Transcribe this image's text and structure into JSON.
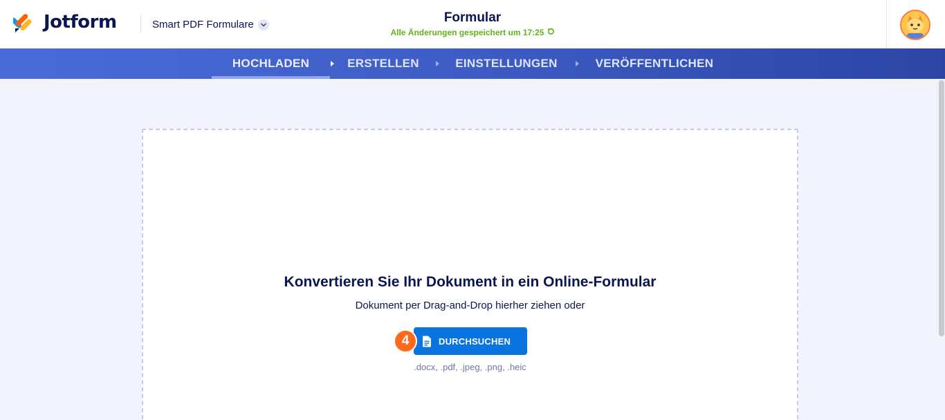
{
  "header": {
    "logo_text": "Jotform",
    "product_label": "Smart PDF Formulare",
    "form_title": "Formular",
    "save_status": "Alle Änderungen gespeichert um 17:25"
  },
  "steps": [
    {
      "label": "HOCHLADEN",
      "active": true
    },
    {
      "label": "ERSTELLEN",
      "active": false
    },
    {
      "label": "EINSTELLUNGEN",
      "active": false
    },
    {
      "label": "VERÖFFENTLICHEN",
      "active": false
    }
  ],
  "upload": {
    "title": "Konvertieren Sie Ihr Dokument in ein Online-Formular",
    "subtitle": "Dokument per Drag-and-Drop hierher ziehen oder",
    "browse_label": "DURCHSUCHEN",
    "formats": ".docx, .pdf, .jpeg, .png, .heic",
    "step_badge": "4"
  },
  "colors": {
    "brand_navy": "#0a1551",
    "primary_button": "#0a75e0",
    "save_green": "#64b21a",
    "badge_orange": "#ff6a1a",
    "steps_bar": "#3f5ec7"
  },
  "icons": [
    "jotform-logo-icon",
    "chevron-down-icon",
    "undo-icon",
    "avatar-icon",
    "document-icon",
    "step-arrow-icon"
  ]
}
